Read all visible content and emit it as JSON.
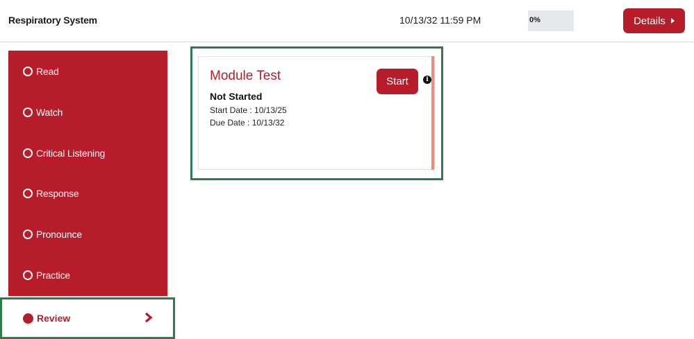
{
  "header": {
    "title": "Respiratory System",
    "datetime": "10/13/32 11:59 PM",
    "progress_label": "0%",
    "progress_value": 0,
    "details_label": "Details"
  },
  "sidebar": {
    "items": [
      {
        "label": "Read"
      },
      {
        "label": "Watch"
      },
      {
        "label": "Critical Listening"
      },
      {
        "label": "Response"
      },
      {
        "label": "Pronounce"
      },
      {
        "label": "Practice"
      }
    ],
    "active_item": {
      "label": "Review"
    }
  },
  "card": {
    "title": "Module Test",
    "status": "Not Started",
    "start_date": "Start Date : 10/13/25",
    "due_date": "Due Date : 10/13/32",
    "start_label": "Start",
    "info_icon": "info-icon"
  },
  "colors": {
    "brand": "#b71c2b",
    "highlight_border": "#2e7a4f",
    "card_accent": "#f08a7e"
  }
}
